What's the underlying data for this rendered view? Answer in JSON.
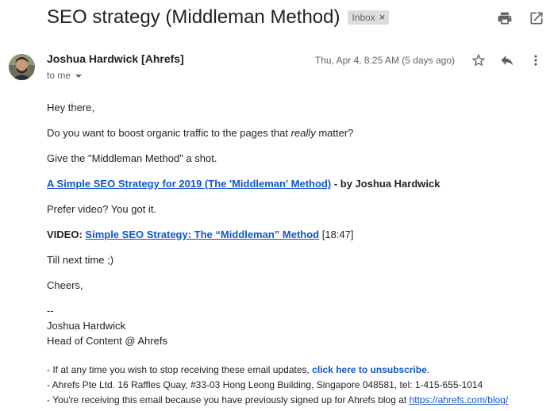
{
  "email": {
    "subject": "SEO strategy (Middleman Method)",
    "label_chip": "Inbox",
    "label_chip_remove": "×",
    "sender": "Joshua Hardwick [Ahrefs]",
    "recipient": "to me",
    "date": "Thu, Apr 4, 8:25 AM (5 days ago)"
  },
  "body": {
    "greeting": "Hey there,",
    "line1_before": "Do you want to boost organic traffic to the pages that ",
    "line1_em": "really",
    "line1_after": " matter?",
    "line2": "Give the \"Middleman Method\" a shot.",
    "article_link": "A Simple SEO Strategy for 2019 (The 'Middleman' Method)",
    "article_byline": " - by Joshua Hardwick",
    "video_prompt": "Prefer video? You got it.",
    "video_label": "VIDEO: ",
    "video_link": "Simple SEO Strategy: The “Middleman” Method",
    "video_duration": " [18:47]",
    "signoff1": "Till next time ;)",
    "signoff2": "Cheers,",
    "sig_dashes": "--",
    "sig_name": "Joshua Hardwick",
    "sig_title": "Head of Content @ Ahrefs"
  },
  "footer": {
    "unsub_before": "- If at any time you wish to stop receiving these email updates, ",
    "unsub_link": "click here to unsubscribe",
    "unsub_after": ".",
    "address": "- Ahrefs Pte Ltd. 16 Raffles Quay, #33-03 Hong Leong Building, Singapore 048581, tel: 1-415-655-1014",
    "reason_before": "- You're receiving this email because you have previously signed up for Ahrefs blog at ",
    "reason_link": "https://ahrefs.com/blog/"
  },
  "icons": {
    "print": "print-icon",
    "open_new_window": "open-in-new-window-icon",
    "star": "star-icon",
    "reply": "reply-icon",
    "more": "more-vertical-icon"
  }
}
